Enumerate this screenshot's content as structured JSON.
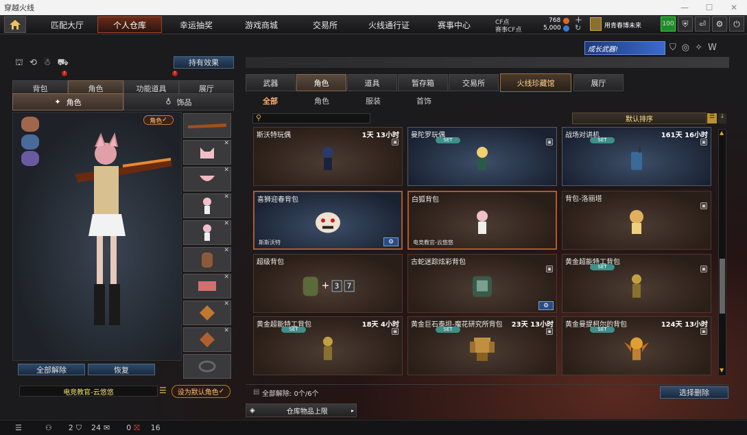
{
  "window": {
    "title": "穿越火线"
  },
  "nav": {
    "tabs": [
      "匹配大厅",
      "个人仓库",
      "幸运抽奖",
      "游戏商城",
      "交易所",
      "火线通行证",
      "赛事中心"
    ],
    "cf_label": "CF点",
    "cf_value": "768",
    "event_cf_label": "赛事CF点",
    "event_cf_value": "5,000",
    "username": "用青春博未来",
    "level": "100"
  },
  "left": {
    "effects_button": "持有效果",
    "tabs": [
      "背包",
      "角色",
      "功能道具",
      "展厅"
    ],
    "subtabs": [
      "角色",
      "饰品"
    ],
    "role_badge": "角色",
    "unequip_all": "全部解除",
    "restore": "恢复",
    "character_name": "电竞教官-云悠悠",
    "set_default": "设为默认角色"
  },
  "right": {
    "tabs": [
      "武器",
      "角色",
      "道具",
      "暂存箱",
      "交易所",
      "火线珍藏馆",
      "展厅"
    ],
    "subtabs": [
      "全部",
      "角色",
      "服装",
      "首饰"
    ],
    "sort_label": "默认排序",
    "items": [
      {
        "name": "斯沃特玩偶",
        "time": "1天 13小时",
        "set": "",
        "owner": ""
      },
      {
        "name": "曼陀罗玩偶",
        "time": "",
        "set": "SET",
        "owner": ""
      },
      {
        "name": "战场对讲机",
        "time": "161天 16小时",
        "set": "SET",
        "owner": ""
      },
      {
        "name": "喜狮迎春背包",
        "time": "",
        "set": "",
        "owner": "斯斯沃特"
      },
      {
        "name": "白狐背包",
        "time": "",
        "set": "",
        "owner": "电竞教官-云悠悠"
      },
      {
        "name": "背包-洛丽塔",
        "time": "",
        "set": "",
        "owner": ""
      },
      {
        "name": "超级背包",
        "time": "",
        "set": "",
        "owner": ""
      },
      {
        "name": "古蛇迷踪炫彩背包",
        "time": "",
        "set": "",
        "owner": ""
      },
      {
        "name": "黄金超能特工背包",
        "time": "",
        "set": "SET",
        "owner": ""
      },
      {
        "name": "黄金超能特工背包",
        "time": "18天 4小时",
        "set": "SET",
        "owner": ""
      },
      {
        "name": "黄金巨石泰坦-魔花研究所背包",
        "time": "23天 13小时",
        "set": "SET",
        "owner": ""
      },
      {
        "name": "黄金曼提柯尔的背包",
        "time": "124天 13小时",
        "set": "SET",
        "owner": ""
      }
    ],
    "super_pack_labels": [
      "3",
      "7"
    ],
    "unequip_count": "全部解除:  0个/6个",
    "select_delete": "选择删除",
    "capacity": "仓库物品上限",
    "banner": "成长武器!"
  },
  "bottom": {
    "count1": "2",
    "count2": "24",
    "count3": "0",
    "count4": "16"
  },
  "colors": {
    "accent": "#b05a2a",
    "set_badge": "#3f8f8a",
    "gear_blue": "#2a4a8a"
  }
}
